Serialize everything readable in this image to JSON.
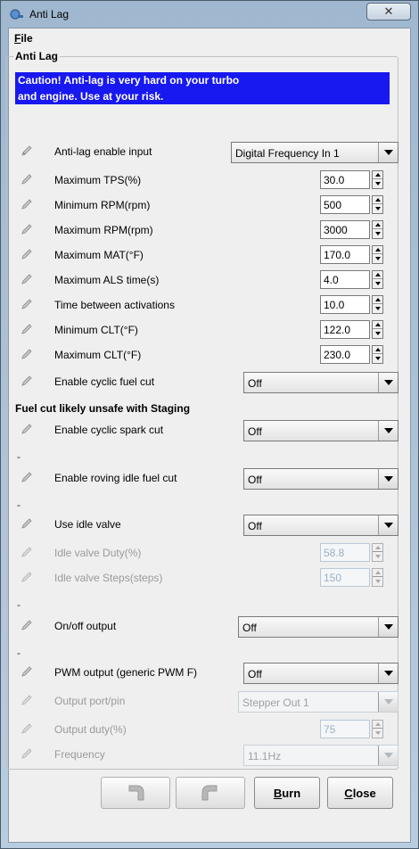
{
  "window": {
    "title": "Anti Lag",
    "close_glyph": "✕"
  },
  "menu": {
    "file_mnemonic": "F",
    "file_rest": "ile"
  },
  "group_title": "Anti Lag",
  "caution": [
    "Caution! Anti-lag is very hard on your turbo",
    " and engine. Use at your risk."
  ],
  "rows": {
    "antilag_input": {
      "label": "Anti-lag enable input",
      "value": "Digital Frequency In 1"
    },
    "max_tps": {
      "label": "Maximum TPS(%)",
      "value": "30.0"
    },
    "min_rpm": {
      "label": "Minimum RPM(rpm)",
      "value": "500"
    },
    "max_rpm": {
      "label": "Maximum RPM(rpm)",
      "value": "3000"
    },
    "max_mat": {
      "label": "Maximum MAT(°F)",
      "value": "170.0"
    },
    "max_als": {
      "label": "Maximum ALS time(s)",
      "value": "4.0"
    },
    "time_between": {
      "label": "Time between activations",
      "value": "10.0"
    },
    "min_clt": {
      "label": "Minimum CLT(°F)",
      "value": "122.0"
    },
    "max_clt": {
      "label": "Maximum CLT(°F)",
      "value": "230.0"
    },
    "cyclic_fuel": {
      "label": "Enable cyclic fuel cut",
      "value": "Off"
    },
    "cyclic_spark": {
      "label": "Enable cyclic spark cut",
      "value": "Off"
    },
    "roving_idle": {
      "label": "Enable roving idle fuel cut",
      "value": "Off"
    },
    "idle_valve": {
      "label": "Use idle valve",
      "value": "Off"
    },
    "idle_duty": {
      "label": "Idle valve Duty(%)",
      "value": "58.8"
    },
    "idle_steps": {
      "label": "Idle valve Steps(steps)",
      "value": "150"
    },
    "onoff_output": {
      "label": "On/off output",
      "value": "Off"
    },
    "pwm_output": {
      "label": "PWM output (generic PWM F)",
      "value": "Off"
    },
    "output_port": {
      "label": "Output port/pin",
      "value": "Stepper Out 1"
    },
    "output_duty": {
      "label": "Output duty(%)",
      "value": "75"
    },
    "frequency": {
      "label": "Frequency",
      "value": "11.1Hz"
    }
  },
  "warning": "Fuel cut likely unsafe with Staging",
  "dash": "-",
  "buttons": {
    "burn_mnemonic": "B",
    "burn_rest": "urn",
    "close_mnemonic": "C",
    "close_rest": "lose"
  },
  "colors": {
    "caution_bg": "#1818f0",
    "caution_text": "#ffffff"
  },
  "icons": {
    "row": "pencil-icon",
    "undo": "undo-arrow-icon",
    "redo": "redo-arrow-icon"
  }
}
